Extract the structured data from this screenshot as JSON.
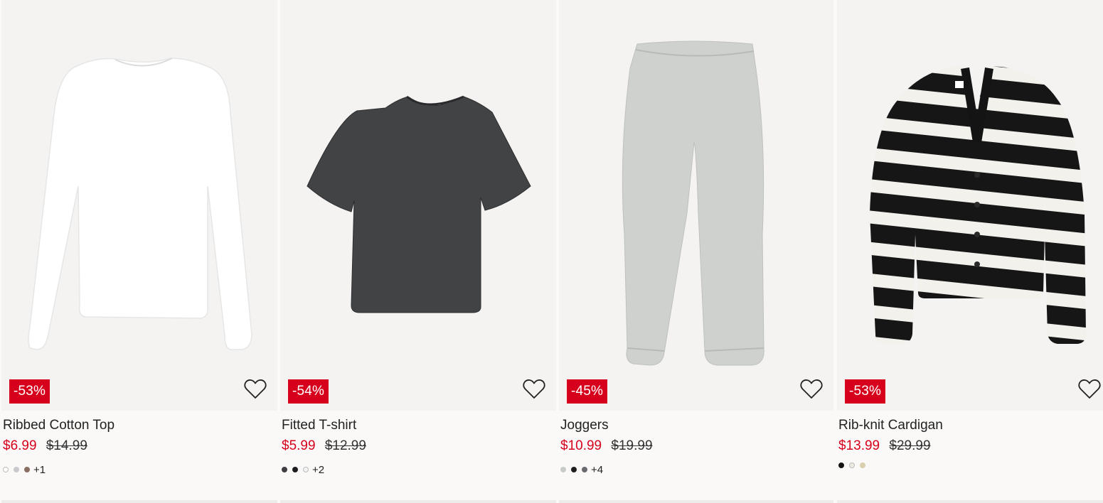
{
  "products": [
    {
      "name": "Ribbed Cotton Top",
      "discount": "-53%",
      "sale_price": "$6.99",
      "original_price": "$14.99",
      "more_colors": "+1",
      "swatches": [
        "#ffffff",
        "#c9c9cc",
        "#8a6e63"
      ]
    },
    {
      "name": "Fitted T-shirt",
      "discount": "-54%",
      "sale_price": "$5.99",
      "original_price": "$12.99",
      "more_colors": "+2",
      "swatches": [
        "#3f3f42",
        "#1d1d1f",
        "#f2f2f2"
      ]
    },
    {
      "name": "Joggers",
      "discount": "-45%",
      "sale_price": "$10.99",
      "original_price": "$19.99",
      "more_colors": "+4",
      "swatches": [
        "#c8c9c9",
        "#1e1e1e",
        "#6a6b6e"
      ]
    },
    {
      "name": "Rib-knit Cardigan",
      "discount": "-53%",
      "sale_price": "$13.99",
      "original_price": "$29.99",
      "more_colors": "",
      "swatches": [
        "#141414",
        "#eeeae0",
        "#d9cfae"
      ]
    }
  ],
  "icons": {
    "favorite": "heart-outline-icon"
  },
  "colors": {
    "sale": "#d6001c",
    "background": "#faf9f8",
    "image_bg": "#f4f3f2"
  }
}
